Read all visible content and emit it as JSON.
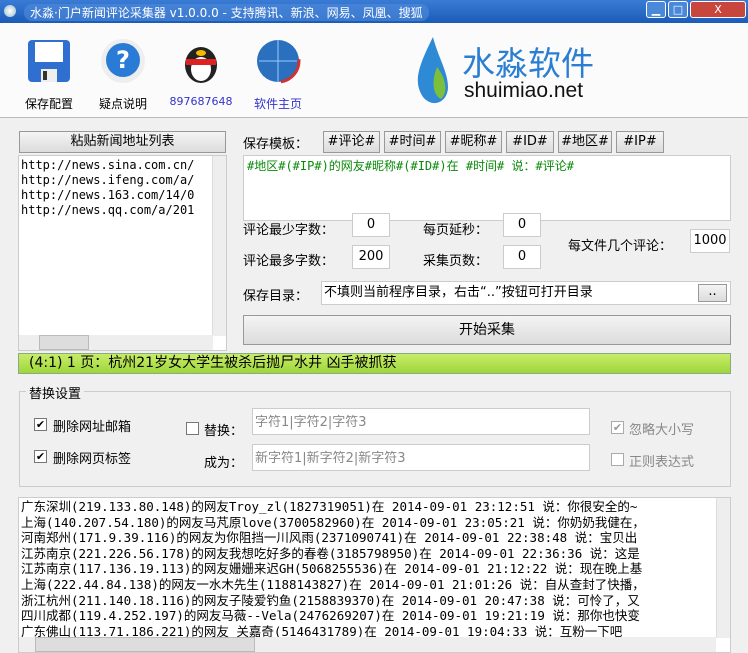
{
  "window": {
    "title": "水淼·门户新闻评论采集器 v1.0.0.0 - 支持腾讯、新浪、网易、凤凰、搜狐",
    "min": "▁",
    "max": "□",
    "close": "X"
  },
  "toolbar": {
    "save": "保存配置",
    "help": "疑点说明",
    "qq": "897687648",
    "home": "软件主页",
    "logo_cn": "水淼软件",
    "logo_en": "shuimiao.net"
  },
  "left": {
    "paste_button": "粘贴新闻地址列表",
    "urls": [
      "http://news.sina.com.cn/",
      "http://news.ifeng.com/a/",
      "http://news.163.com/14/0",
      "http://news.qq.com/a/201"
    ]
  },
  "template": {
    "label": "保存模板：",
    "tags": [
      "#评论#",
      "#时间#",
      "#昵称#",
      "#ID#",
      "#地区#",
      "#IP#"
    ],
    "value": "#地区#(#IP#)的网友#昵称#(#ID#)在 #时间# 说：#评论#"
  },
  "settings": {
    "min_chars_label": "评论最少字数：",
    "min_chars": "0",
    "max_chars_label": "评论最多字数：",
    "max_chars": "200",
    "delay_label": "每页延秒：",
    "delay": "0",
    "pages_label": "采集页数：",
    "pages": "0",
    "per_file_label": "每文件几个评论：",
    "per_file": "1000"
  },
  "save_dir": {
    "label": "保存目录：",
    "placeholder": "不填则当前程序目录，右击“..”按钮可打开目录",
    "browse": ".."
  },
  "start_button": "开始采集",
  "status": "(4:1) 1 页：杭州21岁女大学生被杀后抛尸水井 凶手被抓获",
  "replace": {
    "title": "替换设置",
    "remove_email": "删除网址邮箱",
    "remove_email_checked": true,
    "remove_tags": "删除网页标签",
    "remove_tags_checked": true,
    "replace_label": "替换：",
    "replace_checked": false,
    "replace_value": "字符1|字符2|字符3",
    "to_label": "成为：",
    "to_value": "新字符1|新字符2|新字符3",
    "ignore_case": "忽略大小写",
    "ignore_case_checked": true,
    "regex": "正则表达式",
    "regex_checked": false
  },
  "log": [
    "广东深圳(219.133.80.148)的网友Troy_zl(1827319051)在 2014-09-01 23:12:51 说：你很安全的~",
    "上海(140.207.54.180)的网友马芃原love(3700582960)在 2014-09-01 23:05:21 说：你奶奶我健在，",
    "河南郑州(171.9.39.116)的网友为你阻挡一川风雨(2371090741)在 2014-09-01 22:38:48 说：宝贝出",
    "江苏南京(221.226.56.178)的网友我想吃好多的春卷(3185798950)在 2014-09-01 22:36:36 说：这是",
    "江苏南京(117.136.19.113)的网友姗姗来迟GH(5068255536)在 2014-09-01 21:12:22 说：现在晚上基",
    "上海(222.44.84.138)的网友一水木先生(1188143827)在 2014-09-01 21:01:26 说：自从查封了快播，",
    "浙江杭州(211.140.18.116)的网友子陵爱钓鱼(2158839370)在 2014-09-01 20:47:38 说：可怜了，又",
    "四川成都(119.4.252.197)的网友马薇--Vela(2476269207)在 2014-09-01 19:21:19 说：那你也快变",
    "广东佛山(113.71.186.221)的网友_关嘉奇(5146431789)在 2014-09-01 19:04:33 说：互粉一下吧"
  ]
}
